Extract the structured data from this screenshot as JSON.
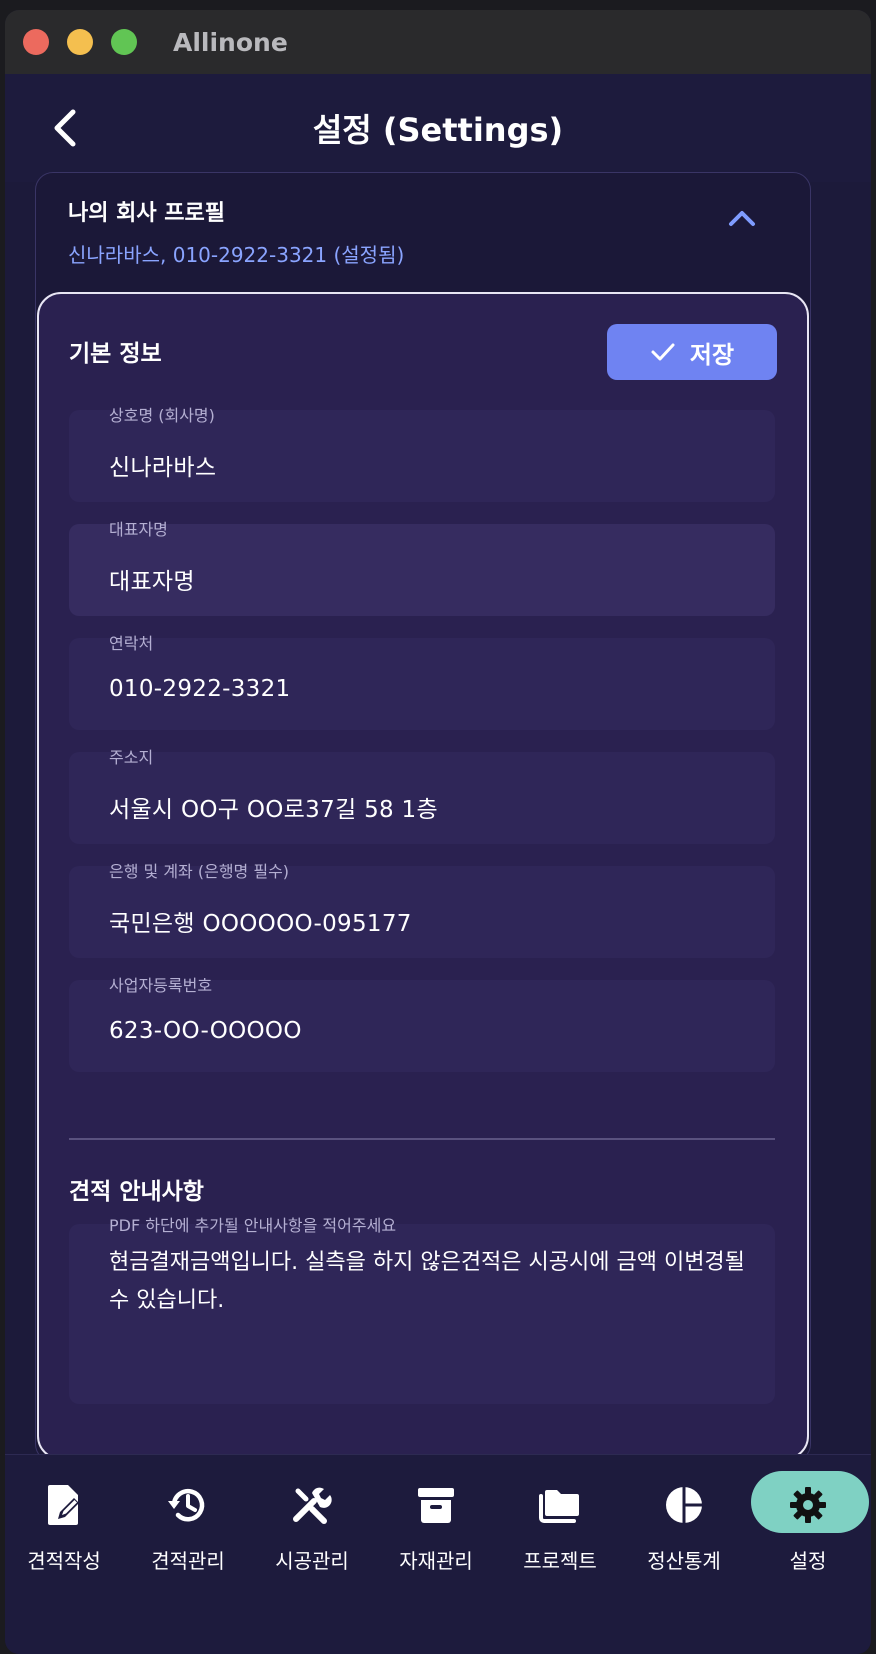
{
  "window": {
    "title": "Allinone"
  },
  "appbar": {
    "title": "설정 (Settings)"
  },
  "profile": {
    "title": "나의 회사 프로필",
    "subtitle": "신나라바스, 010-2922-3321 (설정됨)"
  },
  "basic_info": {
    "title": "기본 정보",
    "save_label": "저장",
    "fields": [
      {
        "label": "상호명 (회사명)",
        "value": "신나라바스"
      },
      {
        "label": "대표자명",
        "value": "대표자명"
      },
      {
        "label": "연락처",
        "value": "010-2922-3321"
      },
      {
        "label": "주소지",
        "value": "서울시 OO구 OO로37길 58 1층"
      },
      {
        "label": "은행 및 계좌 (은행명 필수)",
        "value": "국민은행 OOOOOO-095177"
      },
      {
        "label": "사업자등록번호",
        "value": "623-OO-OOOOO"
      }
    ]
  },
  "notes": {
    "title": "견적 안내사항",
    "label": "PDF 하단에 추가될 안내사항을 적어주세요",
    "value": "현금결재금액입니다. 실측을 하지 않은견적은 시공시에 금액 이변경될수 있습니다."
  },
  "nav": {
    "items": [
      {
        "label": "견적작성",
        "icon": "edit-document-icon"
      },
      {
        "label": "견적관리",
        "icon": "history-icon"
      },
      {
        "label": "시공관리",
        "icon": "tools-icon"
      },
      {
        "label": "자재관리",
        "icon": "archive-box-icon"
      },
      {
        "label": "프로젝트",
        "icon": "folders-icon"
      },
      {
        "label": "정산통계",
        "icon": "pie-chart-icon"
      },
      {
        "label": "설정",
        "icon": "gear-icon"
      }
    ],
    "active": "설정"
  },
  "colors": {
    "accent": "#6f83f2",
    "active_nav": "#7fd1c3",
    "link": "#8aa4ff"
  }
}
